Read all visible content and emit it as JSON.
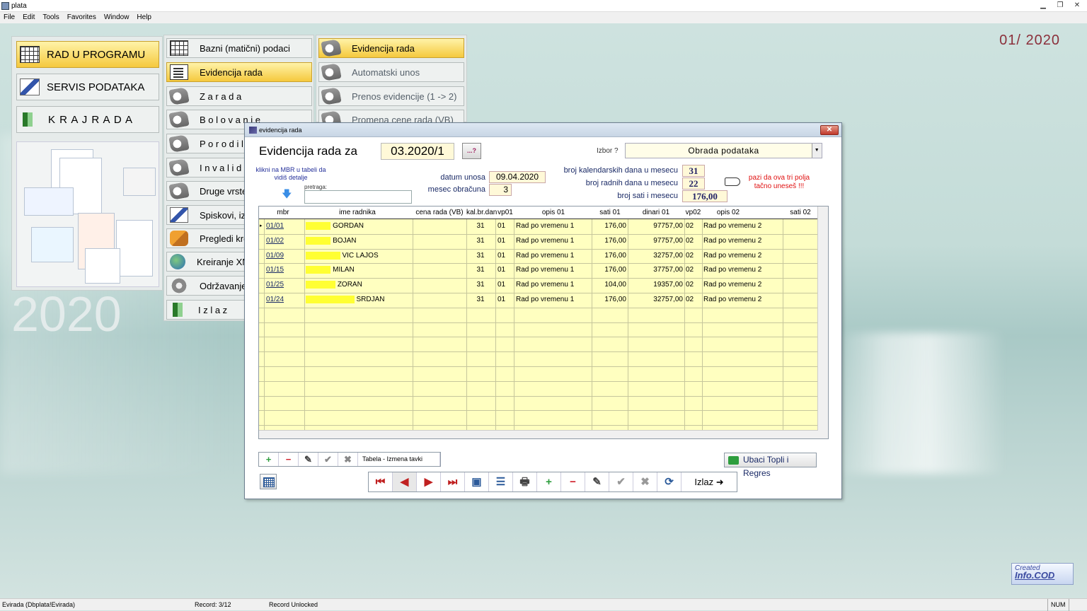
{
  "window": {
    "title": "plata",
    "controls": [
      "▁",
      "❐",
      "✕"
    ]
  },
  "menu": [
    "File",
    "Edit",
    "Tools",
    "Favorites",
    "Window",
    "Help"
  ],
  "period_display": "01/ 2020",
  "year_display": "2020",
  "main_menu": [
    {
      "label": "RAD  U  PROGRAMU",
      "icon": "program-icon",
      "active": true
    },
    {
      "label": "SERVIS PODATAKA",
      "icon": "service-icon",
      "active": false
    },
    {
      "label": "K R A J   R A D A",
      "icon": "exit-door-icon",
      "active": false
    }
  ],
  "sub_menu": [
    {
      "label": "Bazni (matični) podaci",
      "icon": "calculator-icon"
    },
    {
      "label": "Evidencija rada",
      "icon": "document-icon",
      "active": true
    },
    {
      "label": "Z a r a d a",
      "icon": "hand-icon"
    },
    {
      "label": "B o l o v a n j e",
      "icon": "hand-icon"
    },
    {
      "label": "P o r o d i l",
      "icon": "hand-icon"
    },
    {
      "label": "I n v a l i d",
      "icon": "hand-icon"
    },
    {
      "label": "Druge vrste",
      "icon": "hand-icon"
    },
    {
      "label": "Spiskovi, iz",
      "icon": "pen-icon"
    },
    {
      "label": "Pregledi kre",
      "icon": "handshake-icon"
    },
    {
      "label": "Kreiranje XM",
      "icon": "globe-icon"
    },
    {
      "label": "Održavanje",
      "icon": "gear-icon"
    },
    {
      "label": "I z l a z",
      "icon": "exit-door-icon"
    }
  ],
  "sub_menu2": [
    {
      "label": "Evidencija rada",
      "active": true
    },
    {
      "label": "Automatski unos",
      "active": false
    },
    {
      "label": "Prenos evidencije (1 -> 2)",
      "active": false
    },
    {
      "label": "Promena cene rada (VB)",
      "active": false
    }
  ],
  "dialog": {
    "caption": "evidencija rada",
    "close": "✕",
    "title": "Evidencija rada za",
    "period": "03.2020/1",
    "query_btn": "...?",
    "izbor_label": "Izbor ?",
    "izbor_value": "Obrada podataka",
    "izbor_arrow": "▼",
    "hint": "klikni na MBR u tabeli da vidiš detalje",
    "hint_arrow": "🡇",
    "search_label": "pretraga:",
    "search_value": "",
    "datum_label": "datum unosa",
    "datum_value": "09.04.2020",
    "mesec_label": "mesec obračuna",
    "mesec_value": "3",
    "kal_label": "broj kalendarskih dana u mesecu",
    "kal_value": "31",
    "rad_label": "broj  radnih dana u mesecu",
    "rad_value": "22",
    "sati_label": "broj sati i mesecu",
    "sati_value": "176,00",
    "warning": "pazi da ova tri polja tačno uneseš !!!",
    "columns": [
      "mbr",
      "ime radnika",
      "cena rada (VB)",
      "kal.br.dan",
      "vp01",
      "opis 01",
      "sati 01",
      "dinari 01",
      "vp02",
      "opis 02",
      "sati 02"
    ],
    "rows": [
      {
        "mbr": "01/01",
        "redacted": "XXXXX",
        "name": "GORDAN",
        "kal": "31",
        "vp01": "01",
        "opis01": "Rad po vremenu 1",
        "sati01": "176,00",
        "din01": "97757,00",
        "vp02": "02",
        "opis02": "Rad po vremenu 2"
      },
      {
        "mbr": "01/02",
        "redacted": "XXXXX",
        "name": "BOJAN",
        "kal": "31",
        "vp01": "01",
        "opis01": "Rad po vremenu 1",
        "sati01": "176,00",
        "din01": "97757,00",
        "vp02": "02",
        "opis02": "Rad po vremenu 2"
      },
      {
        "mbr": "01/09",
        "redacted": "XXXXXXX",
        "name": "VIC LAJOS",
        "kal": "31",
        "vp01": "01",
        "opis01": "Rad po vremenu 1",
        "sati01": "176,00",
        "din01": "32757,00",
        "vp02": "02",
        "opis02": "Rad po vremenu 2"
      },
      {
        "mbr": "01/15",
        "redacted": "XXXXX",
        "name": "MILAN",
        "kal": "31",
        "vp01": "01",
        "opis01": "Rad po vremenu 1",
        "sati01": "176,00",
        "din01": "37757,00",
        "vp02": "02",
        "opis02": "Rad po vremenu 2"
      },
      {
        "mbr": "01/25",
        "redacted": "XXXXXX",
        "name": "ZORAN",
        "kal": "31",
        "vp01": "01",
        "opis01": "Rad po vremenu 1",
        "sati01": "104,00",
        "din01": "19357,00",
        "vp02": "02",
        "opis02": "Rad po vremenu 2"
      },
      {
        "mbr": "01/24",
        "redacted": "XXXXXXXXXX",
        "name": "SRDJAN",
        "kal": "31",
        "vp01": "01",
        "opis01": "Rad po vremenu 1",
        "sati01": "176,00",
        "din01": "32757,00",
        "vp02": "02",
        "opis02": "Rad po vremenu 2"
      }
    ],
    "table_toolbar": {
      "add": "+",
      "remove": "−",
      "edit": "✎",
      "confirm": "✔",
      "cancel": "✖",
      "label": "Tabela - Izmena tavki"
    },
    "ubaci_label": "Ubaci Topli i Regres",
    "nav": {
      "first": "⏮",
      "prev": "◀",
      "next": "▶",
      "last": "⏭",
      "preview": "▣",
      "form": "☰",
      "print": "🖶",
      "add": "+",
      "remove": "−",
      "edit": "✎",
      "confirm": "✔",
      "cancel": "✖",
      "refresh": "⟳",
      "exit": "Izlaz ➜"
    }
  },
  "logo": {
    "created": "Created",
    "brand": "Info.COD"
  },
  "status": {
    "table": "Evirada (Dbplata!Evirada)",
    "record": "Record: 3/12",
    "lock": "Record Unlocked",
    "num": "NUM"
  },
  "colors": {
    "accent_yellow": "#f5c93e",
    "grid_bg": "#ffffc0",
    "warning": "#e01010",
    "period": "#8b2f3a"
  }
}
